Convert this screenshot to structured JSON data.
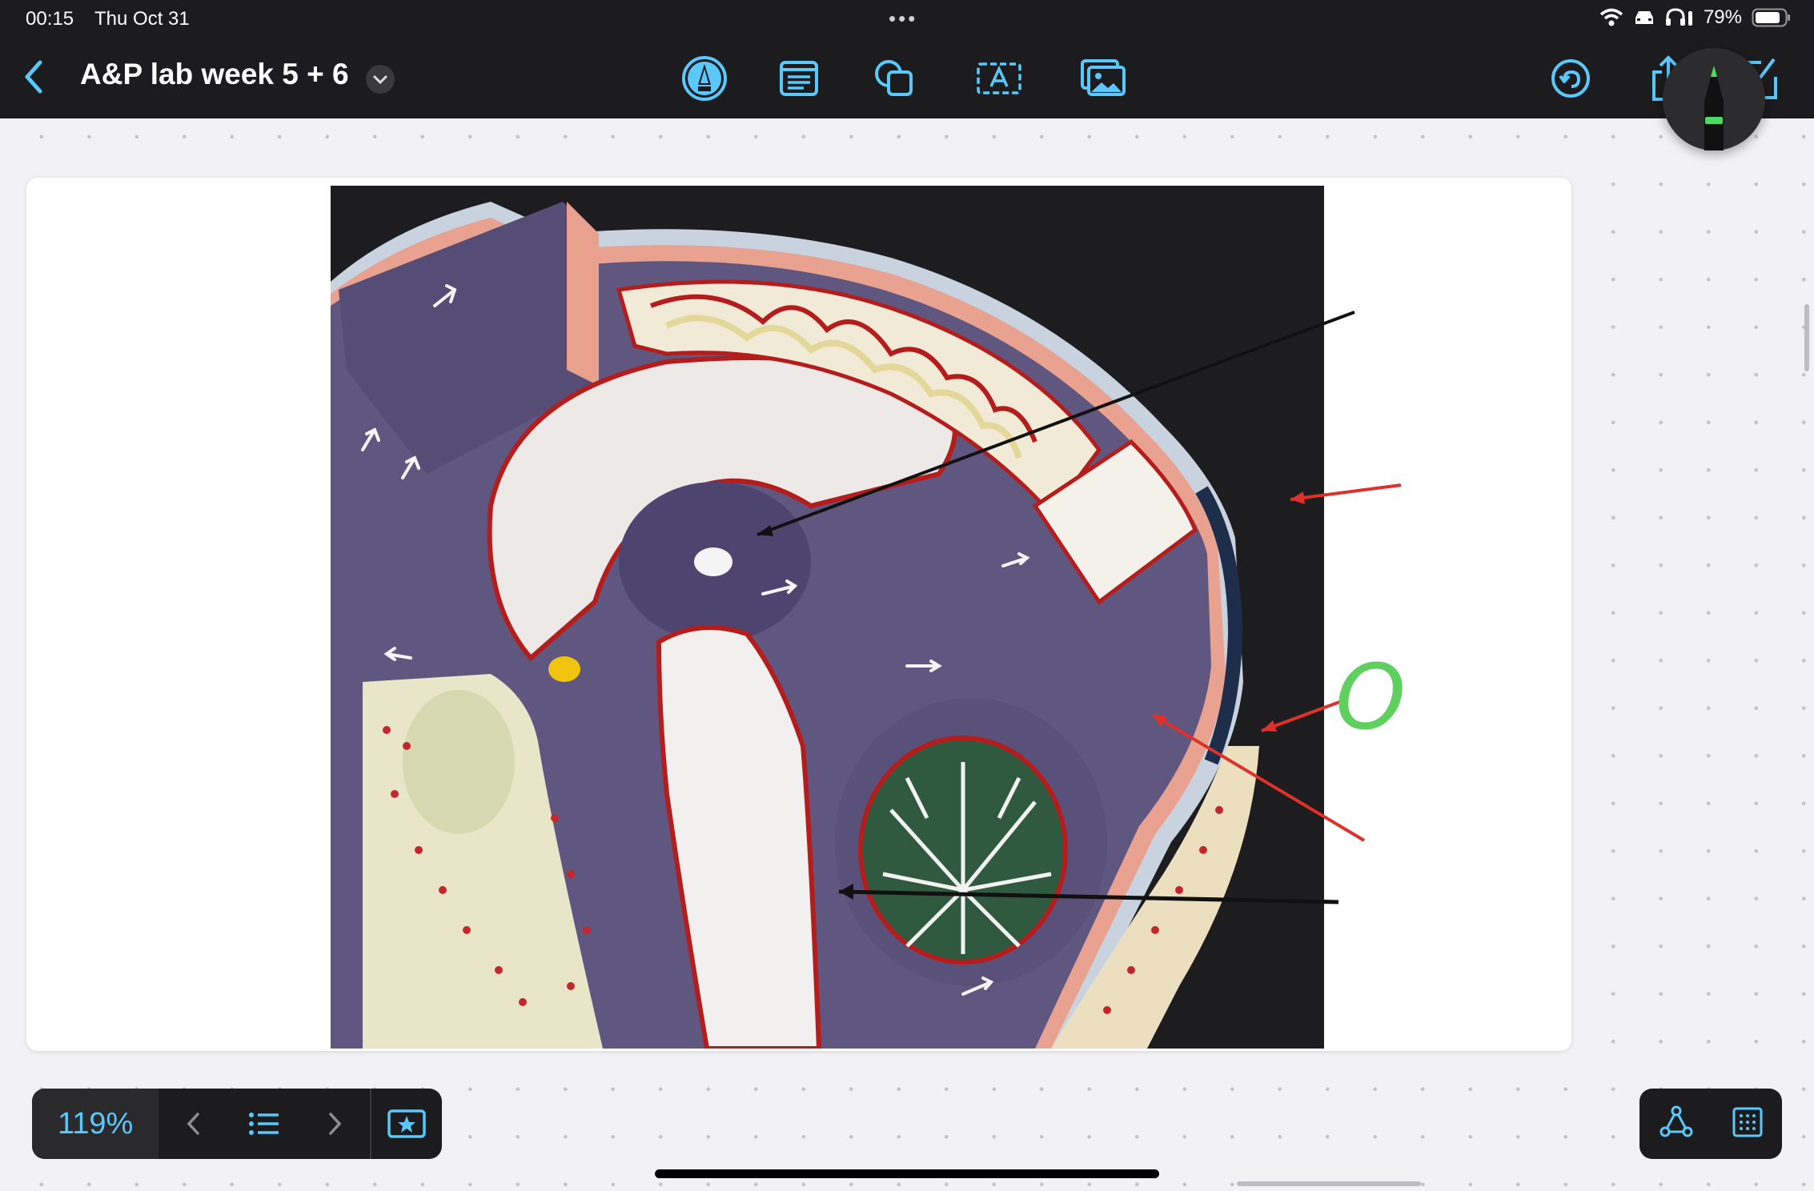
{
  "status_bar": {
    "time": "00:15",
    "date": "Thu Oct 31",
    "battery": "79%",
    "icons": [
      "wifi-icon",
      "car-icon",
      "headphones-icon",
      "battery-icon"
    ]
  },
  "toolbar": {
    "title": "A&P lab week 5 + 6",
    "tools": [
      "pen-tool-icon",
      "note-icon",
      "shapes-icon",
      "text-box-icon",
      "image-insert-icon"
    ],
    "right_tools": [
      "undo-icon",
      "share-icon",
      "compose-icon"
    ]
  },
  "canvas": {
    "handwritten_label": "O",
    "colors": {
      "black_arrow": "#111111",
      "red_arrow": "#e0302a",
      "green_ink": "#5fcf5f"
    }
  },
  "bottom_bar": {
    "zoom": "119%",
    "icons": [
      "previous-page-icon",
      "page-list-icon",
      "next-page-icon",
      "favorite-star-icon"
    ]
  },
  "bottom_right": {
    "icons": [
      "lasso-shape-icon",
      "grid-icon"
    ]
  }
}
